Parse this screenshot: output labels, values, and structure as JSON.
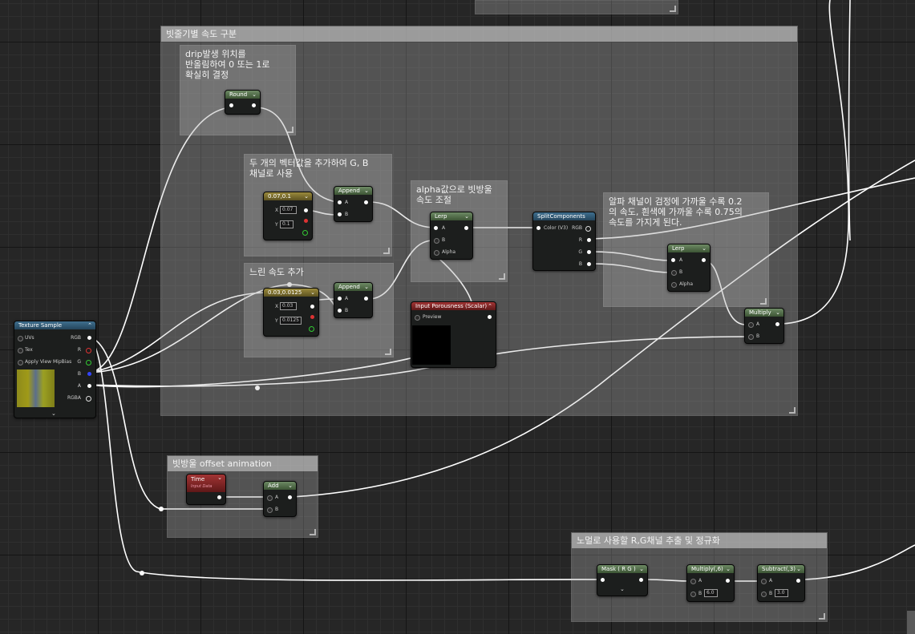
{
  "comments": {
    "speed": "빗줄기별 속도 구분",
    "drip": "drip발생 위치를\n반올림하여 0 또는 1로\n확실히 결정",
    "vector_add": "두 개의 벡터값을 추가하여 G, B\n채널로 사용",
    "slow_speed": "느린 속도 추가",
    "alpha_lerp": "alpha값으로 빗방울\n속도 조절",
    "alpha_channel": "알파 채널이 검정에 가까울 수록 0.2\n의 속도, 흰색에 가까울 수록 0.75의\n속도를 가지게 된다.",
    "offset_anim": "빗방울 offset animation",
    "normal_mask": "노멀로 사용할 R,G채널 추출 및 정규화"
  },
  "nodes": {
    "texture": {
      "title": "Texture Sample",
      "inputs": [
        "UVs",
        "Tex",
        "Apply View MipBias"
      ],
      "outputs": [
        "RGB",
        "R",
        "G",
        "B",
        "A",
        "RGBA"
      ]
    },
    "round": {
      "title": "Round"
    },
    "append1": {
      "title": "Append",
      "a": "A",
      "b": "B"
    },
    "append2": {
      "title": "Append",
      "a": "A",
      "b": "B"
    },
    "const1": {
      "title": "0.07,0.1",
      "x_label": "X",
      "x_value": "0.07",
      "y_label": "Y",
      "y_value": "0.1"
    },
    "const2": {
      "title": "0.03,0.0125",
      "x_label": "X",
      "x_value": "0.03",
      "y_label": "Y",
      "y_value": "0.0125"
    },
    "lerp1": {
      "title": "Lerp",
      "a": "A",
      "b": "B",
      "alpha": "Alpha"
    },
    "lerp2": {
      "title": "Lerp",
      "a": "A",
      "b": "B",
      "alpha": "Alpha"
    },
    "split": {
      "title": "SplitComponents",
      "input": "Color (V3)",
      "outputs": [
        "RGB",
        "R",
        "G",
        "B"
      ]
    },
    "porosity": {
      "title": "Input Porousness (Scalar)",
      "preview": "Preview"
    },
    "multiply": {
      "title": "Multiply",
      "a": "A",
      "b": "B"
    },
    "time": {
      "title": "Time",
      "subtitle": "Input Data"
    },
    "add": {
      "title": "Add",
      "a": "A",
      "b": "B"
    },
    "mask": {
      "title": "Mask ( R G )"
    },
    "multiply6": {
      "title": "Multiply(,6)",
      "a": "A",
      "b_label": "B",
      "b_value": "6.0"
    },
    "subtract3": {
      "title": "Subtract(,3)",
      "a": "A",
      "b_label": "B",
      "b_value": "3.0"
    }
  },
  "colors": {
    "wire": "#ffffff",
    "comment_fill": "#bebebe",
    "background": "#262626"
  }
}
